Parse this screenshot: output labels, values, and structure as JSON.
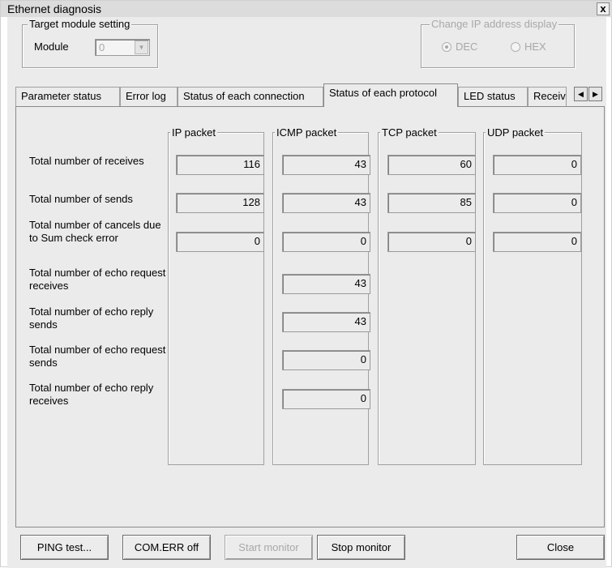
{
  "window": {
    "title": "Ethernet diagnosis",
    "close_glyph": "x"
  },
  "target_module": {
    "group_title": "Target module setting",
    "module_label": "Module",
    "module_value": "0"
  },
  "ip_display": {
    "group_title": "Change IP address display",
    "dec_label": "DEC",
    "hex_label": "HEX",
    "selected": "DEC"
  },
  "tabs": [
    {
      "label": "Parameter status"
    },
    {
      "label": "Error log"
    },
    {
      "label": "Status of each connection"
    },
    {
      "label": "Status of each protocol"
    },
    {
      "label": "LED status"
    },
    {
      "label": "Receiv"
    }
  ],
  "active_tab": "Status of each protocol",
  "columns": [
    "IP packet",
    "ICMP packet",
    "TCP packet",
    "UDP packet"
  ],
  "rows": [
    {
      "label": "Total number of receives",
      "ip": "116",
      "icmp": "43",
      "tcp": "60",
      "udp": "0"
    },
    {
      "label": "Total number of sends",
      "ip": "128",
      "icmp": "43",
      "tcp": "85",
      "udp": "0"
    },
    {
      "label": "Total number of cancels due to Sum check error",
      "ip": "0",
      "icmp": "0",
      "tcp": "0",
      "udp": "0"
    },
    {
      "label": "Total number of echo request receives",
      "icmp": "43"
    },
    {
      "label": "Total number of echo reply sends",
      "icmp": "43"
    },
    {
      "label": "Total number of echo request sends",
      "icmp": "0"
    },
    {
      "label": "Total number of echo reply receives",
      "icmp": "0"
    }
  ],
  "buttons": {
    "ping": "PING test...",
    "comerr": "COM.ERR off",
    "start": "Start monitor",
    "stop": "Stop monitor",
    "close": "Close"
  }
}
